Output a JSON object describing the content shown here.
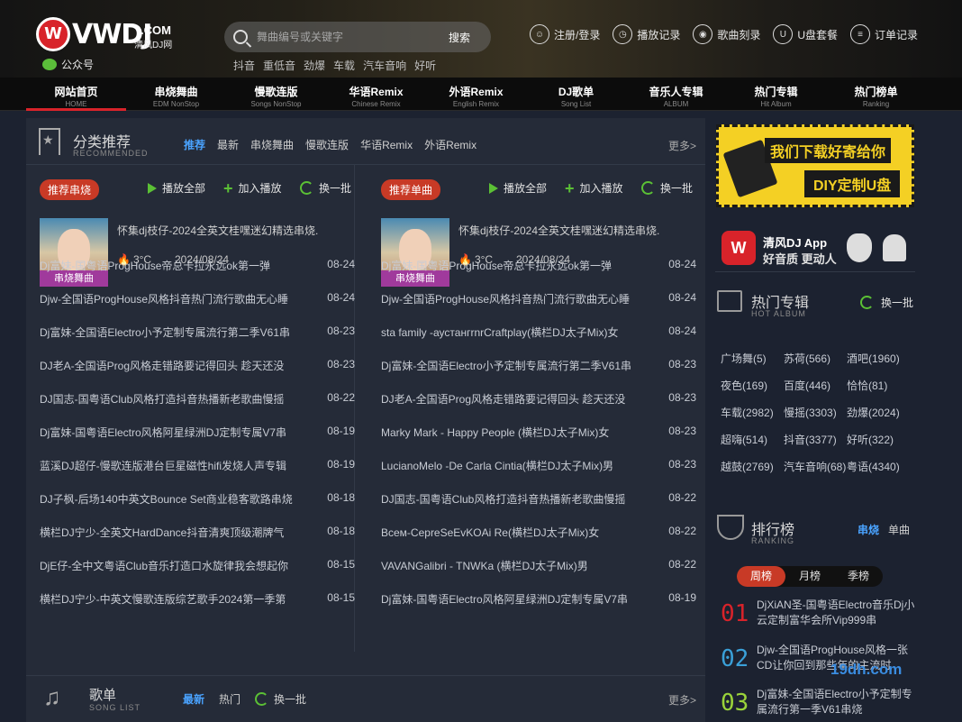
{
  "header": {
    "logo_badge": "W",
    "logo_text": "VWDJ",
    "logo_com": ".COM",
    "logo_sub": "清风DJ网",
    "wechat_label": "公众号",
    "search_placeholder": "舞曲编号或关键字",
    "search_button": "搜索",
    "hotwords": [
      "抖音",
      "重低音",
      "劲爆",
      "车载",
      "汽车音响",
      "好听"
    ],
    "links": [
      {
        "label": "注册/登录",
        "icon": "user-icon"
      },
      {
        "label": "播放记录",
        "icon": "clock-icon"
      },
      {
        "label": "歌曲刻录",
        "icon": "disc-icon"
      },
      {
        "label": "U盘套餐",
        "icon": "usb-icon"
      },
      {
        "label": "订单记录",
        "icon": "order-icon"
      }
    ]
  },
  "nav": [
    {
      "cn": "网站首页",
      "en": "HOME"
    },
    {
      "cn": "串烧舞曲",
      "en": "EDM NonStop"
    },
    {
      "cn": "慢歌连版",
      "en": "Songs NonStop"
    },
    {
      "cn": "华语Remix",
      "en": "Chinese Remix"
    },
    {
      "cn": "外语Remix",
      "en": "English Remix"
    },
    {
      "cn": "DJ歌单",
      "en": "Song List"
    },
    {
      "cn": "音乐人专辑",
      "en": "ALBUM"
    },
    {
      "cn": "热门专辑",
      "en": "Hit Album"
    },
    {
      "cn": "热门榜单",
      "en": "Ranking"
    }
  ],
  "recommend": {
    "title": "分类推荐",
    "title_en": "RECOMMENDED",
    "tabs": [
      "推荐",
      "最新",
      "串烧舞曲",
      "慢歌连版",
      "华语Remix",
      "外语Remix"
    ],
    "more": "更多>",
    "play_all": "播放全部",
    "add_play": "加入播放",
    "refresh": "换一批",
    "left": {
      "pill": "推荐串烧",
      "feat_title": "怀集dj枝仔-2024全英文桂嘿迷幻精选串烧.",
      "feat_tag": "串烧舞曲",
      "feat_temp": "3°C",
      "feat_date": "2024/08/24",
      "rows": [
        {
          "t": "Dj富妹-国粤语ProgHouse帝总卡拉永远ok第一弹",
          "d": "08-24"
        },
        {
          "t": "Djw-全国语ProgHouse风格抖音热门流行歌曲无心睡",
          "d": "08-24"
        },
        {
          "t": "Dj富妹-全国语Electro小予定制专属流行第二季V61串",
          "d": "08-23"
        },
        {
          "t": "DJ老A-全国语Prog风格走错路要记得回头 趁天还没",
          "d": "08-23"
        },
        {
          "t": "DJ国志-国粤语Club风格打造抖音热播新老歌曲慢摇",
          "d": "08-22"
        },
        {
          "t": "Dj富妹-国粤语Electro风格阿星绿洲DJ定制专属V7串",
          "d": "08-19"
        },
        {
          "t": "蓝溪DJ超仔-慢歌连版港台巨星磁性hifi发烧人声专辑",
          "d": "08-19"
        },
        {
          "t": "DJ子枫-后场140中英文Bounce Set商业稳客歌路串烧",
          "d": "08-18"
        },
        {
          "t": "横栏DJ宁少-全英文HardDance抖音清爽顶级潮牌气",
          "d": "08-18"
        },
        {
          "t": "DjE仔-全中文粤语Club音乐打造口水旋律我会想起你",
          "d": "08-15"
        },
        {
          "t": "横栏DJ宁少-中英文慢歌连版综艺歌手2024第一季第",
          "d": "08-15"
        }
      ]
    },
    "right": {
      "pill": "推荐单曲",
      "feat_title": "怀集dj枝仔-2024全英文桂嘿迷幻精选串烧.",
      "feat_tag": "串烧舞曲",
      "feat_temp": "3°C",
      "feat_date": "2024/08/24",
      "rows": [
        {
          "t": "Dj富妹-国粤语ProgHouse帝总卡拉永远ok第一弹",
          "d": "08-24"
        },
        {
          "t": "Djw-全国语ProgHouse风格抖音热门流行歌曲无心睡",
          "d": "08-24"
        },
        {
          "t": "sta family -аустангrnrCraftplay(横栏DJ太子Mix)女",
          "d": "08-24"
        },
        {
          "t": "Dj富妹-全国语Electro小予定制专属流行第二季V61串",
          "d": "08-23"
        },
        {
          "t": "DJ老A-全国语Prog风格走错路要记得回头 趁天还没",
          "d": "08-23"
        },
        {
          "t": "Marky Mark - Happy People (横栏DJ太子Mix)女",
          "d": "08-23"
        },
        {
          "t": "LucianoMelo -De Carla Cintia(横栏DJ太子Mix)男",
          "d": "08-23"
        },
        {
          "t": "DJ国志-国粤语Club风格打造抖音热播新老歌曲慢摇",
          "d": "08-22"
        },
        {
          "t": "Всем-CepreSeEvKOAi Re(横栏DJ太子Mix)女",
          "d": "08-22"
        },
        {
          "t": "VAVANGalibri - TNWKa (横栏DJ太子Mix)男",
          "d": "08-22"
        },
        {
          "t": "Dj富妹-国粤语Electro风格阿星绿洲DJ定制专属V7串",
          "d": "08-19"
        }
      ]
    }
  },
  "songlist": {
    "title": "歌单",
    "title_en": "SONG LIST",
    "tabs": [
      "最新",
      "热门"
    ],
    "refresh": "换一批",
    "more": "更多>"
  },
  "sidebar": {
    "ad_top": "我们下载好寄给你",
    "ad_bottom": "DIY定制U盘",
    "app_name": "清风DJ App",
    "app_slogan": "好音质  更动人",
    "hot_title": "热门专辑",
    "hot_en": "HOT ALBUM",
    "hot_refresh": "换一批",
    "tags": [
      "广场舞(5)",
      "苏荷(566)",
      "酒吧(1960)",
      "夜色(169)",
      "百度(446)",
      "恰恰(81)",
      "车载(2982)",
      "慢摇(3303)",
      "劲爆(2024)",
      "超嗨(514)",
      "抖音(3377)",
      "好听(322)",
      "越鼓(2769)",
      "汽车音响(68)",
      "粤语(4340)"
    ],
    "rank_title": "排行榜",
    "rank_en": "RANKING",
    "rank_switch": [
      "串烧",
      "单曲"
    ],
    "rank_tabs": [
      "周榜",
      "月榜",
      "季榜"
    ],
    "rank_items": [
      {
        "num": "01",
        "color": "#d8232a",
        "text": "DjXiAN圣-国粤语Electro音乐Dj小云定制富华会所Vip999串"
      },
      {
        "num": "02",
        "color": "#3aa0d8",
        "text": "Djw-全国语ProgHouse风格一张CD让你回到那些年的主流时"
      },
      {
        "num": "03",
        "color": "#9ad33a",
        "text": "Dj富妹-全国语Electro小予定制专属流行第一季V61串烧"
      }
    ]
  },
  "watermark": "19dh.com",
  "colors": {
    "accent_red": "#d8232a",
    "accent_green": "#5bc035",
    "accent_blue": "#4aa3ff",
    "pill": "#c83a26"
  }
}
